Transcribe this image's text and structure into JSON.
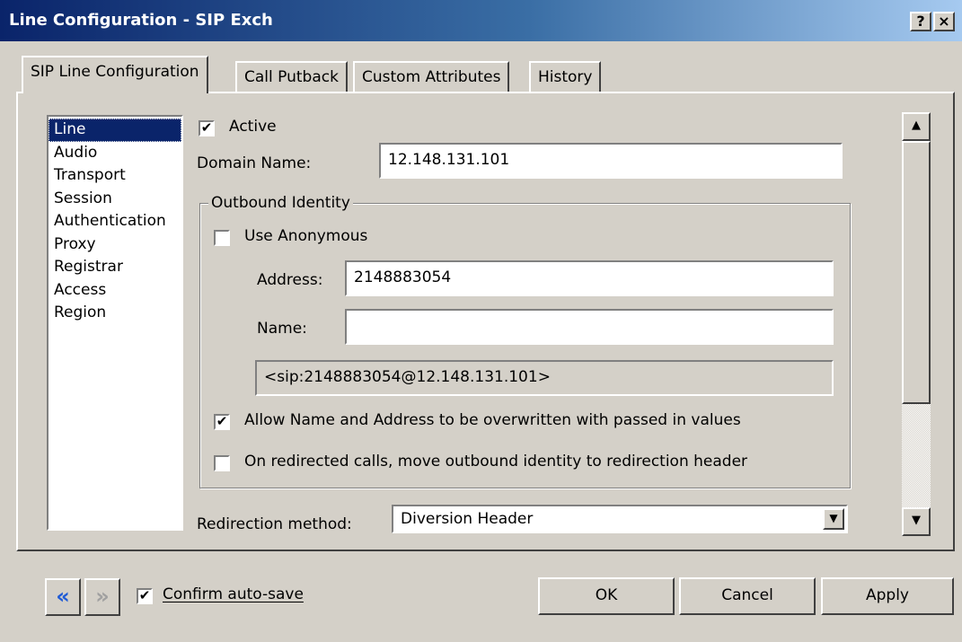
{
  "window": {
    "title": "Line Configuration - SIP Exch",
    "help_label": "?",
    "close_label": "×"
  },
  "tabs": [
    {
      "label": "SIP Line Configuration"
    },
    {
      "label": "Call Putback"
    },
    {
      "label": "Custom Attributes"
    },
    {
      "label": "History"
    }
  ],
  "sidebar": {
    "items": [
      {
        "label": "Line"
      },
      {
        "label": "Audio"
      },
      {
        "label": "Transport"
      },
      {
        "label": "Session"
      },
      {
        "label": "Authentication"
      },
      {
        "label": "Proxy"
      },
      {
        "label": "Registrar"
      },
      {
        "label": "Access"
      },
      {
        "label": "Region"
      }
    ]
  },
  "line": {
    "active_label": "Active",
    "active_mark": "✔",
    "domain_label": "Domain Name:",
    "domain_value": "12.148.131.101"
  },
  "outbound": {
    "group_label": "Outbound Identity",
    "anonymous_label": "Use Anonymous",
    "address_label": "Address:",
    "address_value": "2148883054",
    "name_label": "Name:",
    "name_value": "",
    "uri_value": "<sip:2148883054@12.148.131.101>",
    "overwrite_label": "Allow Name and Address to be overwritten with passed in values",
    "overwrite_mark": "✔",
    "redirect_label": "On redirected calls, move outbound identity to redirection header"
  },
  "redirection": {
    "label": "Redirection method:",
    "value": "Diversion Header",
    "arrow": "▼"
  },
  "scrollbar": {
    "up": "▲",
    "down": "▼"
  },
  "footer": {
    "back_glyph": "«",
    "forward_glyph": "»",
    "confirm_mark": "✔",
    "confirm_label": "Confirm auto-save",
    "ok_label": "OK",
    "cancel_label": "Cancel",
    "apply_label": "Apply"
  }
}
